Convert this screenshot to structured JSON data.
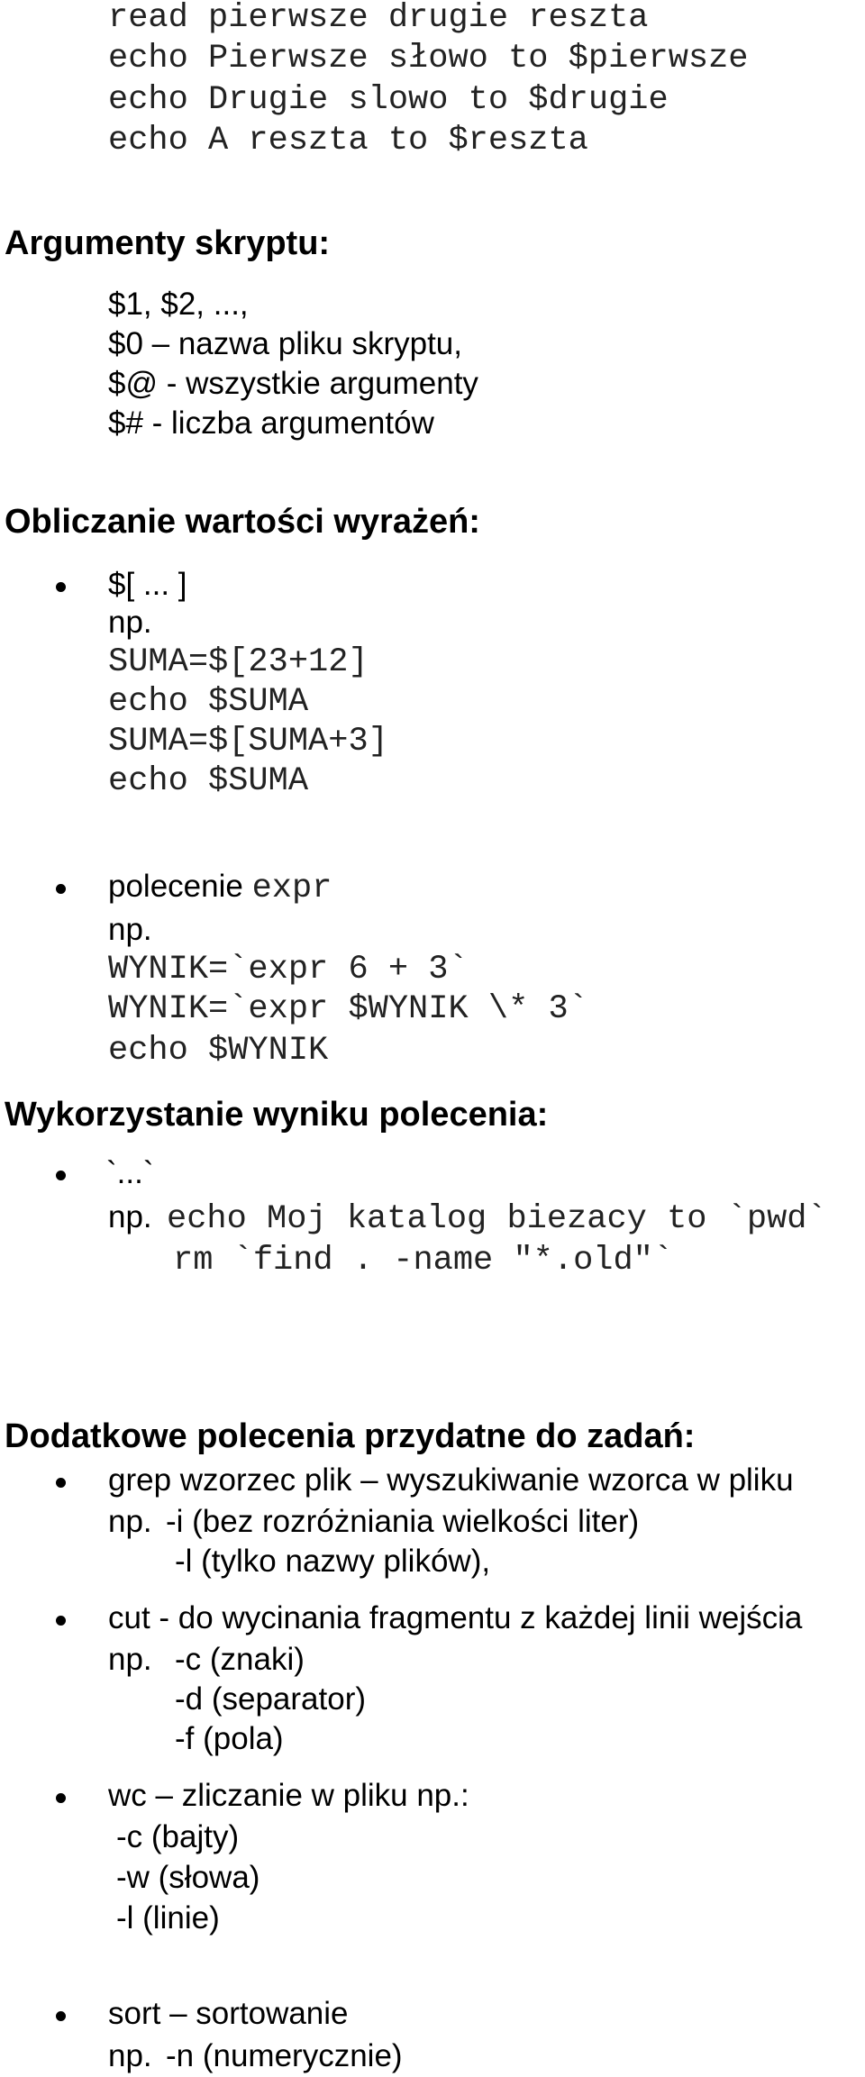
{
  "read_block": {
    "lines": [
      "read pierwsze drugie reszta",
      "echo Pierwsze słowo to $pierwsze",
      "echo Drugie slowo to $drugie",
      "echo A reszta to $reszta"
    ]
  },
  "arguments": {
    "heading": "Argumenty skryptu:",
    "items": [
      "$1, $2, ...,",
      "$0 – nazwa pliku skryptu,",
      "$@ - wszystkie argumenty",
      "$# - liczba argumentów"
    ]
  },
  "expressions": {
    "heading": "Obliczanie wartości wyrażeń:",
    "bracket": {
      "label": "$[ ... ]",
      "example_label": "np.",
      "code": [
        "SUMA=$[23+12]",
        "echo $SUMA",
        "SUMA=$[SUMA+3]",
        "echo $SUMA"
      ]
    },
    "expr": {
      "label": "polecenie",
      "command": "expr",
      "example_label": "np.",
      "code": [
        "WYNIK=`expr 6 + 3`",
        "WYNIK=`expr $WYNIK \\* 3`",
        "echo $WYNIK"
      ]
    }
  },
  "command_output": {
    "heading": "Wykorzystanie wyniku polecenia:",
    "label": "`...`",
    "example_label": "np.",
    "code": [
      "echo Moj katalog biezacy to `pwd`",
      "rm `find . -name \"*.old\"`"
    ]
  },
  "extra_commands": {
    "heading": "Dodatkowe polecenia przydatne do zadań:",
    "grep": {
      "title": "grep wzorzec plik – wyszukiwanie wzorca w pliku",
      "example_label": "np.",
      "options": [
        "-i (bez rozróżniania wielkości liter)",
        "-l (tylko nazwy plików),"
      ]
    },
    "cut": {
      "title": "cut - do wycinania fragmentu z każdej linii wejścia",
      "example_label": "np.",
      "options": [
        "-c (znaki)",
        "-d (separator)",
        "-f (pola)"
      ]
    },
    "wc": {
      "title": "wc – zliczanie w pliku np.:",
      "options": [
        "-c (bajty)",
        "-w (słowa)",
        "-l (linie)"
      ]
    },
    "sort": {
      "title": "sort – sortowanie",
      "example_label": "np.",
      "options": [
        "-n (numerycznie)"
      ]
    }
  }
}
